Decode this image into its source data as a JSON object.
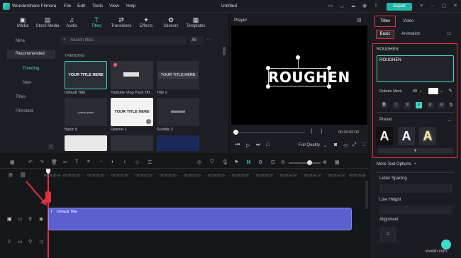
{
  "app": {
    "name": "Wondershare Filmora",
    "project": "Untitled",
    "menu": [
      "File",
      "Edit",
      "Tools",
      "View",
      "Help"
    ],
    "export_label": "Export"
  },
  "nav": {
    "tabs": [
      {
        "label": "Media",
        "icon": "media-icon"
      },
      {
        "label": "Stock Media",
        "icon": "stock-media-icon"
      },
      {
        "label": "Audio",
        "icon": "audio-icon"
      },
      {
        "label": "Titles",
        "icon": "titles-icon"
      },
      {
        "label": "Transitions",
        "icon": "transitions-icon"
      },
      {
        "label": "Effects",
        "icon": "effects-icon"
      },
      {
        "label": "Stickers",
        "icon": "stickers-icon"
      },
      {
        "label": "Templates",
        "icon": "templates-icon"
      }
    ]
  },
  "categories": {
    "mine": "Mine",
    "recommended": "Recommended",
    "trending": "Trending",
    "new": "New",
    "titles": "Titles",
    "filmstock": "Filmstock"
  },
  "search": {
    "placeholder": "Search titles",
    "filter": "All"
  },
  "section": "TRENDING",
  "thumbs": [
    {
      "label": "Default Title",
      "preview": "YOUR TITLE HERE"
    },
    {
      "label": "Youtube Vlog Pack Titl...",
      "preview": ""
    },
    {
      "label": "Title 2",
      "preview": "YOUR TITLE HERE"
    },
    {
      "label": "Basic 6",
      "preview": "Lorem ipsum"
    },
    {
      "label": "Opener 1",
      "preview": "YOUR TITLE HERE"
    },
    {
      "label": "Subtitle 2",
      "preview": ""
    }
  ],
  "player": {
    "label": "Player",
    "preview_text": "ROUGHEN",
    "time": "00:00:00:00",
    "quality": "Full Quality"
  },
  "right": {
    "tab_titles": "Titles",
    "tab_video": "Video",
    "sub_basic": "Basic",
    "sub_animation": "Animation",
    "section": "ROUGHEN",
    "text_value": "ROUGHEN",
    "font": "Roboto Med",
    "size": "80",
    "preset": "Preset",
    "more": "More Text Options",
    "letter_spacing": "Letter Spacing",
    "line_height": "Line Height",
    "alignment": "Alignment",
    "colors": {
      "accent": "#3fd9c9",
      "highlight": "#e0303f"
    }
  },
  "timeline": {
    "ticks": [
      "00:00:00:00",
      "00:00:00:10",
      "00:00:00:20",
      "00:00:01:05",
      "00:00:01:15",
      "00:00:02:00",
      "00:00:02:10",
      "00:00:02:20",
      "00:00:03:05",
      "00:00:03:15",
      "00:00:04:00",
      "00:00:04:10",
      "00:00:04:20",
      "00:00:05:05"
    ],
    "clip": "Default Title"
  },
  "watermark": "wvxdn.com"
}
